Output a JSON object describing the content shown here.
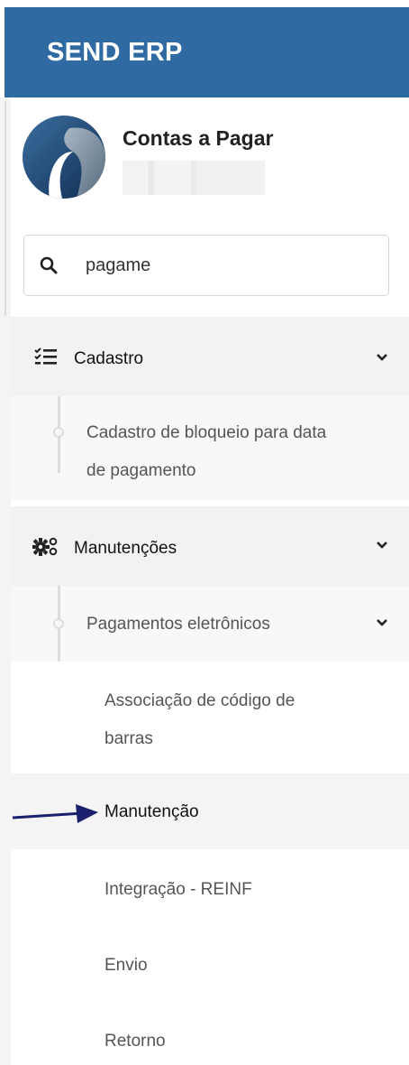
{
  "app": {
    "title": "SEND ERP"
  },
  "user": {
    "name": "Contas a Pagar",
    "subtitle_redacted": true
  },
  "search": {
    "value": "pagame",
    "icon": "search-icon"
  },
  "colors": {
    "header_bg": "#2f6aa3",
    "arrow": "#1a1f6e"
  },
  "menu": {
    "cadastro": {
      "label": "Cadastro",
      "icon": "checklist-icon",
      "items": [
        {
          "line1": "Cadastro de bloqueio para data",
          "line2": "de pagamento"
        }
      ]
    },
    "manutencoes": {
      "label": "Manutenções",
      "icon": "gears-icon",
      "submenu": {
        "label": "Pagamentos eletrônicos",
        "items": [
          {
            "line1": "Associação de código de",
            "line2": "barras"
          },
          {
            "label": "Manutenção",
            "active": true
          },
          {
            "label": "Integração - REINF"
          },
          {
            "label": "Envio"
          },
          {
            "label": "Retorno"
          }
        ]
      }
    }
  }
}
